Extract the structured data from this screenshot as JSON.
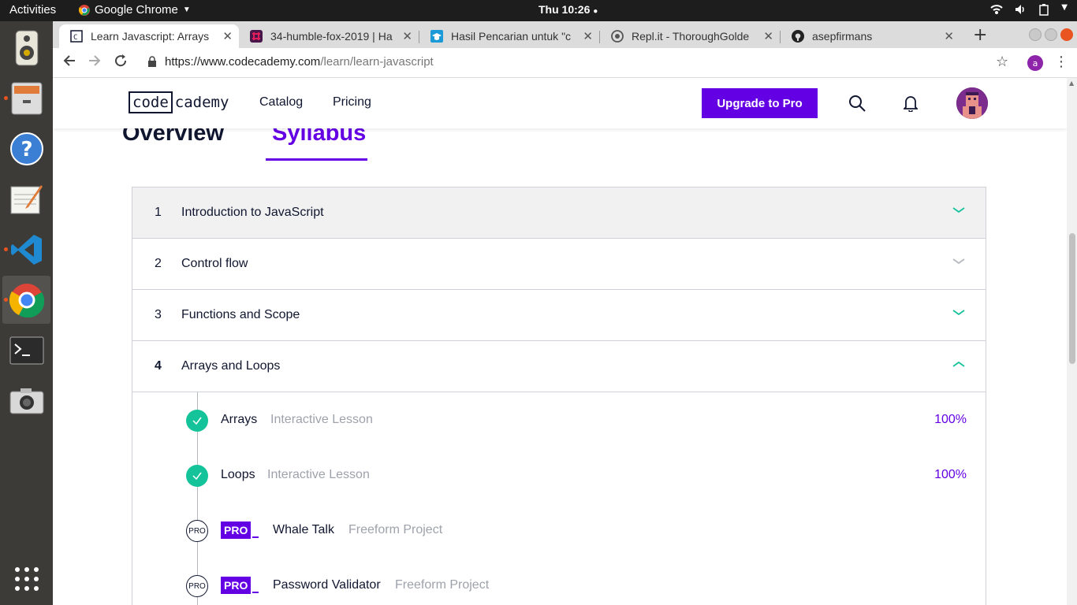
{
  "system": {
    "activities": "Activities",
    "app_name": "Google Chrome",
    "clock": "Thu 10:26"
  },
  "browser": {
    "tabs": [
      {
        "title": "Learn Javascript: Arrays",
        "active": true
      },
      {
        "title": "34-humble-fox-2019 | Ha"
      },
      {
        "title": "Hasil Pencarian untuk \"c"
      },
      {
        "title": "Repl.it - ThoroughGolde"
      },
      {
        "title": "asepfirmans"
      }
    ],
    "url_host": "https://www.codecademy.com",
    "url_path": "/learn/learn-javascript",
    "profile_initial": "a"
  },
  "site": {
    "logo_box": "code",
    "logo_rest": "cademy",
    "nav": {
      "catalog": "Catalog",
      "pricing": "Pricing"
    },
    "upgrade_label": "Upgrade to Pro",
    "brand_color": "#6400e4",
    "accent_color": "#15c39a"
  },
  "page_tabs": {
    "overview": "Overview",
    "syllabus": "Syllabus"
  },
  "modules": [
    {
      "num": "1",
      "title": "Introduction to JavaScript",
      "state": "collapsed"
    },
    {
      "num": "2",
      "title": "Control flow",
      "state": "collapsed"
    },
    {
      "num": "3",
      "title": "Functions and Scope",
      "state": "collapsed"
    },
    {
      "num": "4",
      "title": "Arrays and Loops",
      "state": "expanded"
    }
  ],
  "lessons": [
    {
      "name": "Arrays",
      "type": "Interactive Lesson",
      "progress": "100%",
      "status": "complete"
    },
    {
      "name": "Loops",
      "type": "Interactive Lesson",
      "progress": "100%",
      "status": "complete"
    },
    {
      "name": "Whale Talk",
      "type": "Freeform Project",
      "status": "pro",
      "mark": "PRO",
      "badge": "PRO"
    },
    {
      "name": "Password Validator",
      "type": "Freeform Project",
      "status": "pro",
      "mark": "PRO",
      "badge": "PRO"
    }
  ]
}
